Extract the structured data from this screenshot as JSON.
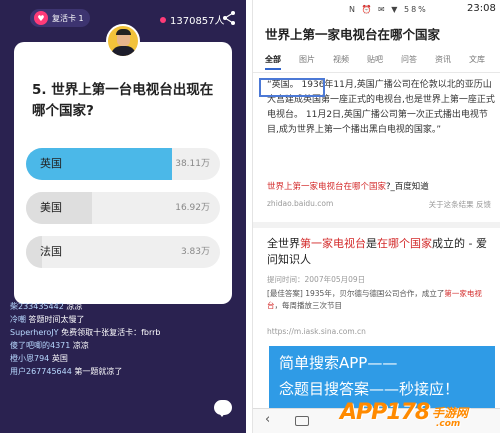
{
  "quiz_app": {
    "revive_card_label": "复活卡 1",
    "viewer_count": "1370857人",
    "question": "5. 世界上第一台电视台出现在哪个国家?",
    "options": [
      {
        "label": "英国",
        "count": "38.11万",
        "fraction": 0.75,
        "correct": true
      },
      {
        "label": "美国",
        "count": "16.92万",
        "fraction": 0.34,
        "correct": false
      },
      {
        "label": "法国",
        "count": "3.83万",
        "fraction": 0.08,
        "correct": false
      }
    ],
    "chat": [
      {
        "user": "柴233435442",
        "text": "凉凉"
      },
      {
        "user": "冷嘲",
        "text": "答题时间太慢了"
      },
      {
        "user": "SuperheroJY",
        "text": "免费领取十张复活卡：fbrrb"
      },
      {
        "user": "傻了吧唧的4371",
        "text": "凉凉"
      },
      {
        "user": "橙小恩794",
        "text": "英国"
      },
      {
        "user": "用户267745644",
        "text": "第一题就凉了"
      }
    ]
  },
  "search_app": {
    "status_icons": "N ⏰ ✉ ▼ 58%",
    "clock": "23:08",
    "query_title": "世界上第一家电视台在哪个国家",
    "tabs": [
      "全部",
      "图片",
      "视频",
      "贴吧",
      "问答",
      "资讯",
      "文库"
    ],
    "answer_text": "“英国。 1936年11月,英国广播公司在伦敦以北的亚历山大宫建成英国第一座正式的电视台,也是世界上第一座正式电视台。 11月2日,英国广播公司第一次正式播出电视节目,成为世界上第一个播出黑白电视的国家。”",
    "result1": {
      "title_red": "世界上第一家电视台在哪个国家",
      "title_rest": "?_百度知道",
      "source": "zhidao.baidu.com",
      "actions": "关于这条结果    反馈"
    },
    "result2": {
      "title_part1": "全世界",
      "title_red1": "第一家电视台",
      "title_part2": "是",
      "title_red2": "在哪个国家",
      "title_part3": "成立的 - 爱问知识人",
      "date": "提问时间：2007年05月09日",
      "snippet_prefix": "[最佳答案] 1935年，贝尔德与德国公司合作，成立了",
      "snippet_red": "第一家电视台",
      "snippet_suffix": "，每周播放三次节目",
      "url": "https://m.iask.sina.com.cn"
    },
    "ad": {
      "line1": "简单搜索APP——",
      "line2": "念题目搜答案——秒接应！"
    }
  },
  "watermark": {
    "main": "APP178",
    "cn": "手游网",
    "domain": ".com"
  },
  "colors": {
    "quiz_bg": "#2a2250",
    "correct_fill": "#4bb8e8",
    "accent_pink": "#ff3b78",
    "search_red": "#d32b2b",
    "ad_blue": "#2f9be6"
  }
}
